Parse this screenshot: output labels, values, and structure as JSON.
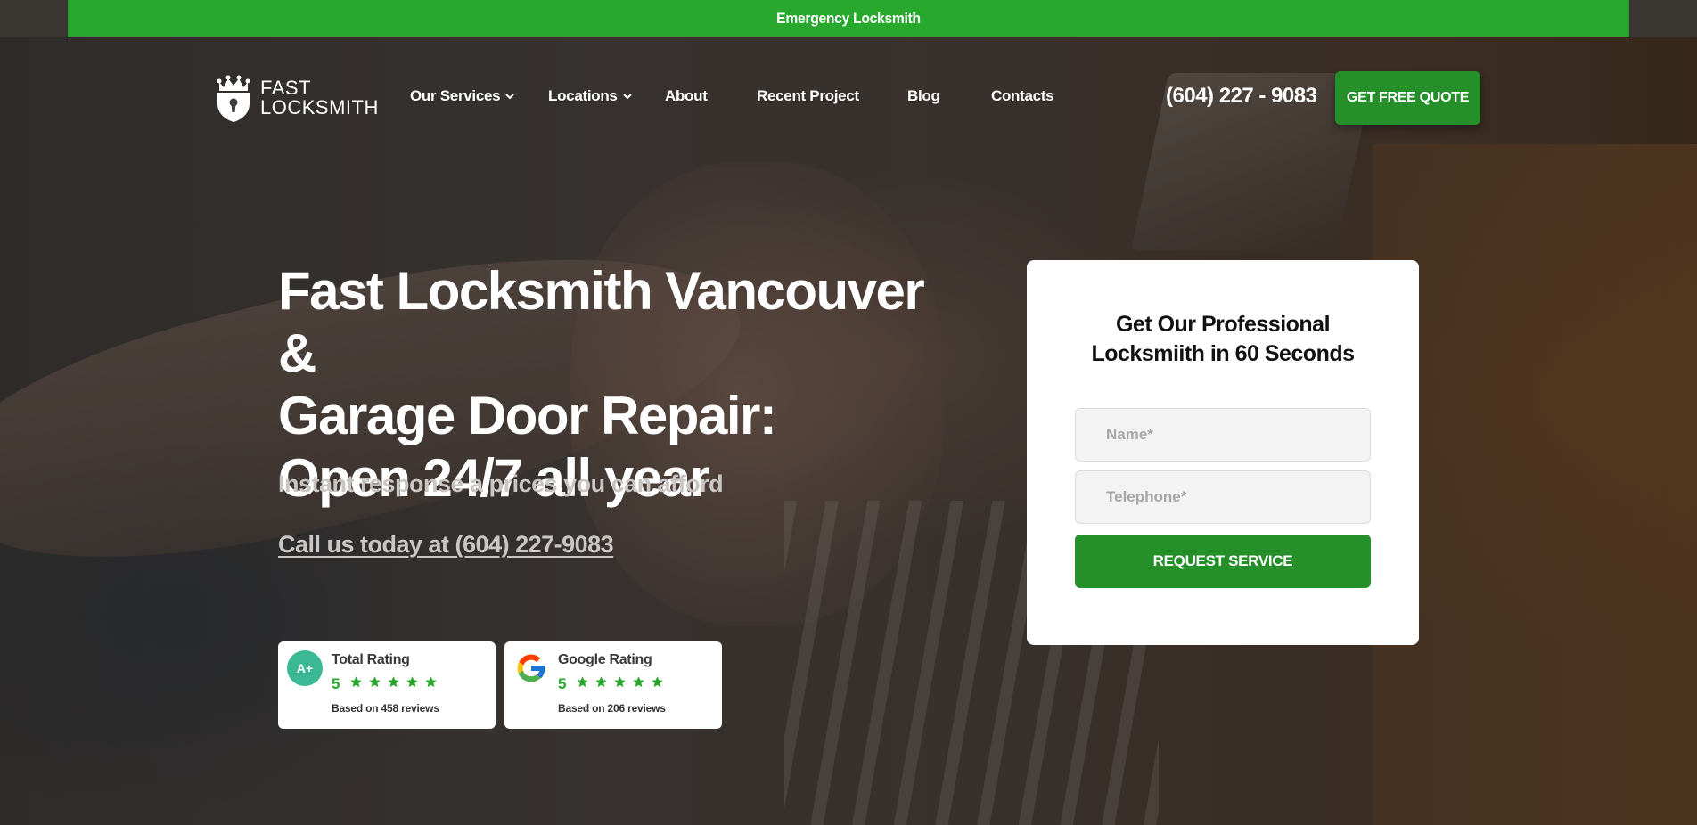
{
  "topbar": {
    "text": "Emergency Locksmith"
  },
  "header": {
    "logo_line1": "FAST",
    "logo_line2": "LOCKSMITH",
    "nav": [
      {
        "label": "Our Services",
        "dropdown": true
      },
      {
        "label": "Locations",
        "dropdown": true
      },
      {
        "label": "About",
        "dropdown": false
      },
      {
        "label": "Recent Project",
        "dropdown": false
      },
      {
        "label": "Blog",
        "dropdown": false
      },
      {
        "label": "Contacts",
        "dropdown": false
      }
    ],
    "phone": "(604) 227 - 9083",
    "quote_button": "GET FREE QUOTE"
  },
  "hero": {
    "title_line1": "Fast Locksmith Vancouver &",
    "title_line2": "Garage Door Repair:",
    "title_line3": "Open 24/7 all year",
    "subtitle": "Instant response a prices you can afford",
    "call_link": "Call us today at (604) 227-9083"
  },
  "ratings": [
    {
      "badge": "A+",
      "title": "Total Rating",
      "score": "5",
      "stars": 5,
      "note": "Based on 458 reviews"
    },
    {
      "badge": "google-icon",
      "title": "Google Rating",
      "score": "5",
      "stars": 5,
      "note": "Based on 206 reviews"
    }
  ],
  "form": {
    "title_line1": "Get Our Professional",
    "title_line2": "Locksmiith in 60 Seconds",
    "name_placeholder": "Name*",
    "phone_placeholder": "Telephone*",
    "submit_label": "REQUEST SERVICE"
  },
  "colors": {
    "brand_green": "#28a82d",
    "button_green": "#258f2a",
    "rating_badge": "#3bb894"
  }
}
